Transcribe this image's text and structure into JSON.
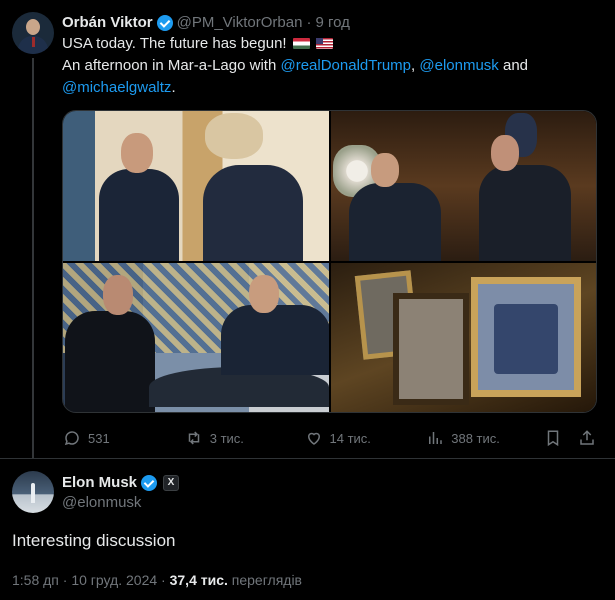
{
  "orban_post": {
    "name": "Orbán Viktor",
    "handle": "@PM_ViktorOrban",
    "separator": "·",
    "time": "9 год",
    "line1": "USA today. The future has begun!",
    "line2_prefix": "An afternoon in Mar-a-Lago with",
    "mention1": "@realDonaldTrump",
    "comma": ",",
    "mention2": "@elonmusk",
    "and_word": "and",
    "mention3": "@michaelgwaltz",
    "period": ".",
    "flags": [
      "hungary-flag",
      "usa-flag"
    ],
    "photos": [
      "handshake-photo",
      "handshake-room-photo",
      "table-meeting-photo",
      "framed-pictures-photo"
    ],
    "actions": {
      "replies": "531",
      "reposts": "3 тис.",
      "likes": "14 тис.",
      "views": "388 тис."
    }
  },
  "musk_post": {
    "name": "Elon Musk",
    "handle": "@elonmusk",
    "badge": "X",
    "text": "Interesting discussion",
    "timestamp": "1:58 дп · 10 груд. 2024 ·",
    "views_count": "37,4 тис.",
    "views_label": "переглядів"
  },
  "colors": {
    "background": "#000000",
    "accent": "#1d9bf0",
    "secondary_text": "#71767b",
    "primary_text": "#e7e9ea"
  }
}
